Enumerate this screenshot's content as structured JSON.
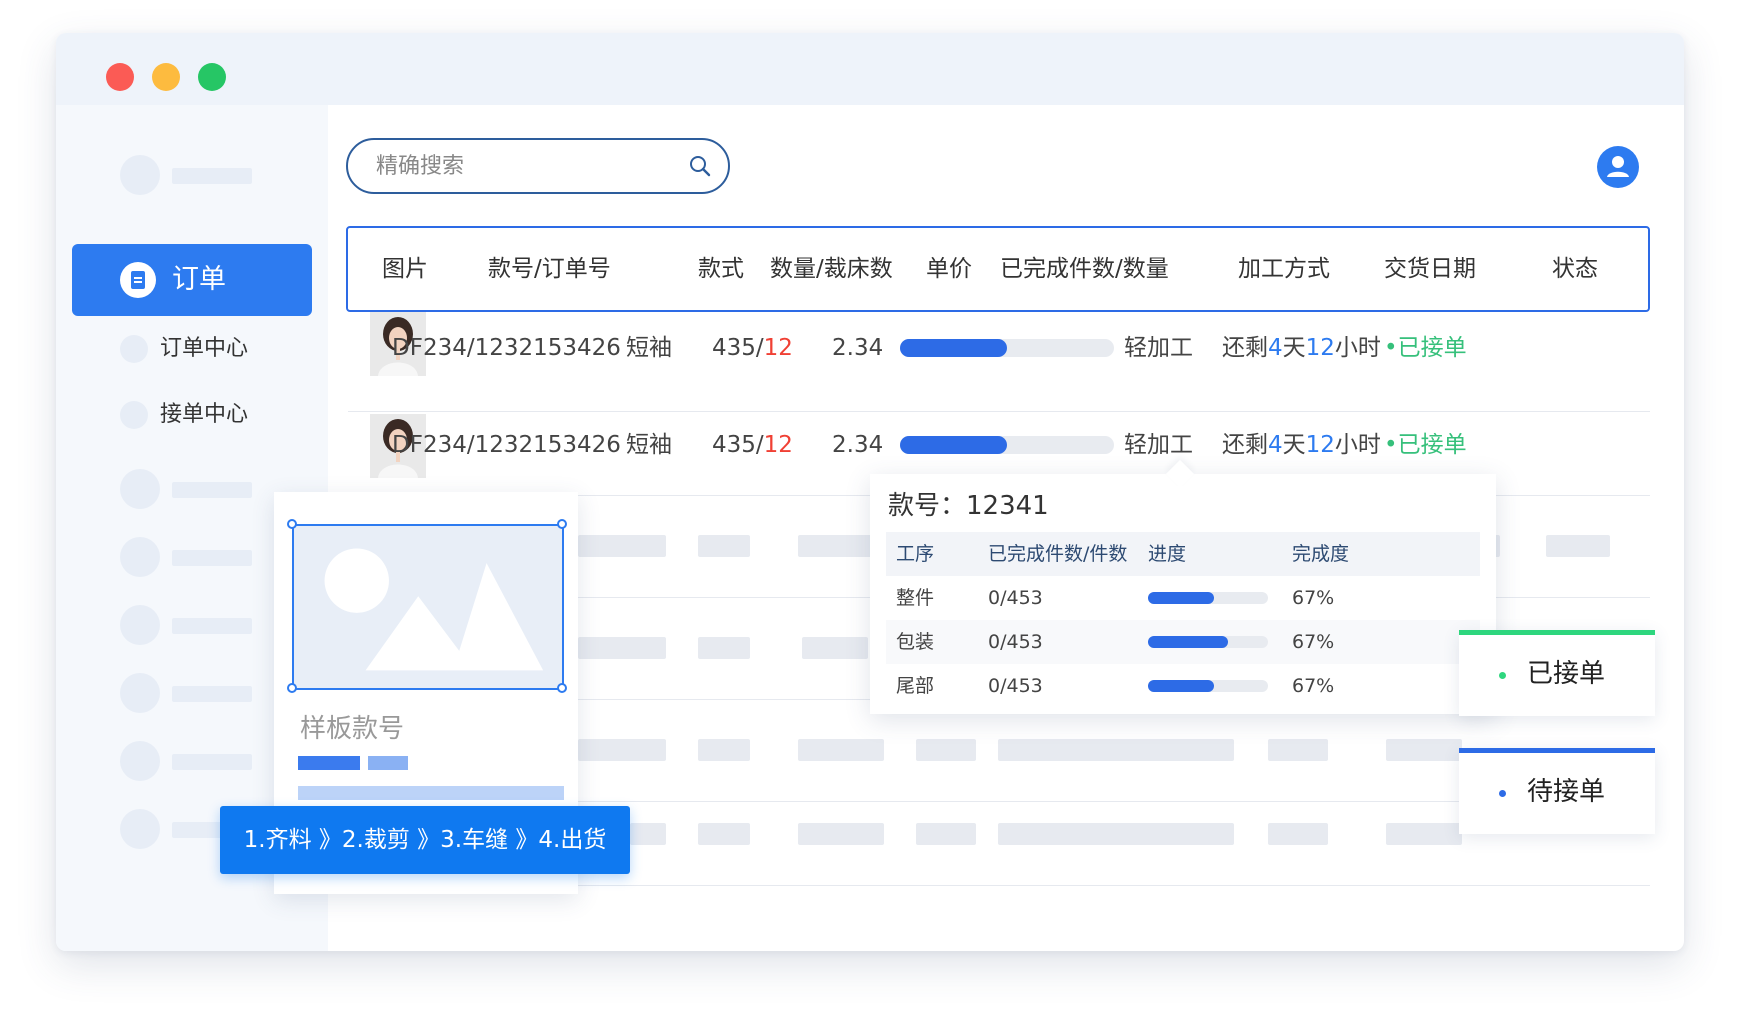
{
  "window": {
    "controls": [
      "close",
      "minimize",
      "maximize"
    ]
  },
  "sidebar": {
    "active_item": {
      "label": "订单",
      "icon": "document-icon"
    },
    "sub_items": [
      {
        "label": "订单中心"
      },
      {
        "label": "接单中心"
      }
    ]
  },
  "search": {
    "placeholder": "精确搜索",
    "value": ""
  },
  "table": {
    "columns": [
      "图片",
      "款号/订单号",
      "款式",
      "数量/裁床数",
      "单价",
      "已完成件数/数量",
      "加工方式",
      "交货日期",
      "状态"
    ],
    "rows": [
      {
        "order_no": "DF234/1232153426",
        "style": "短袖",
        "qty": "435/",
        "cut_qty": "12",
        "price": "2.34",
        "progress": 0.5,
        "method": "轻加工",
        "delivery_prefix": "还剩",
        "delivery_days": "4",
        "delivery_mid": "天",
        "delivery_hours": "12",
        "delivery_suffix": "小时",
        "status": "•已接单"
      },
      {
        "order_no": "DF234/1232153426",
        "style": "短袖",
        "qty": "435/",
        "cut_qty": "12",
        "price": "2.34",
        "progress": 0.5,
        "method": "轻加工",
        "delivery_prefix": "还剩",
        "delivery_days": "4",
        "delivery_mid": "天",
        "delivery_hours": "12",
        "delivery_suffix": "小时",
        "status": "•已接单"
      }
    ]
  },
  "sample_card": {
    "title": "样板款号"
  },
  "process_banner": {
    "text": "1.齐料 》2.裁剪 》3.车缝 》4.出货"
  },
  "popover": {
    "title": "款号：12341",
    "columns": [
      "工序",
      "已完成件数/件数",
      "进度",
      "完成度"
    ],
    "rows": [
      {
        "step": "整件",
        "done": "0/453",
        "progress": 0.55,
        "pct": "67%"
      },
      {
        "step": "包装",
        "done": "0/453",
        "progress": 0.67,
        "pct": "67%"
      },
      {
        "step": "尾部",
        "done": "0/453",
        "progress": 0.55,
        "pct": "67%"
      }
    ]
  },
  "status_legend": [
    {
      "label": "已接单",
      "color": "#2ed67e"
    },
    {
      "label": "待接单",
      "color": "#2d6be6"
    }
  ]
}
